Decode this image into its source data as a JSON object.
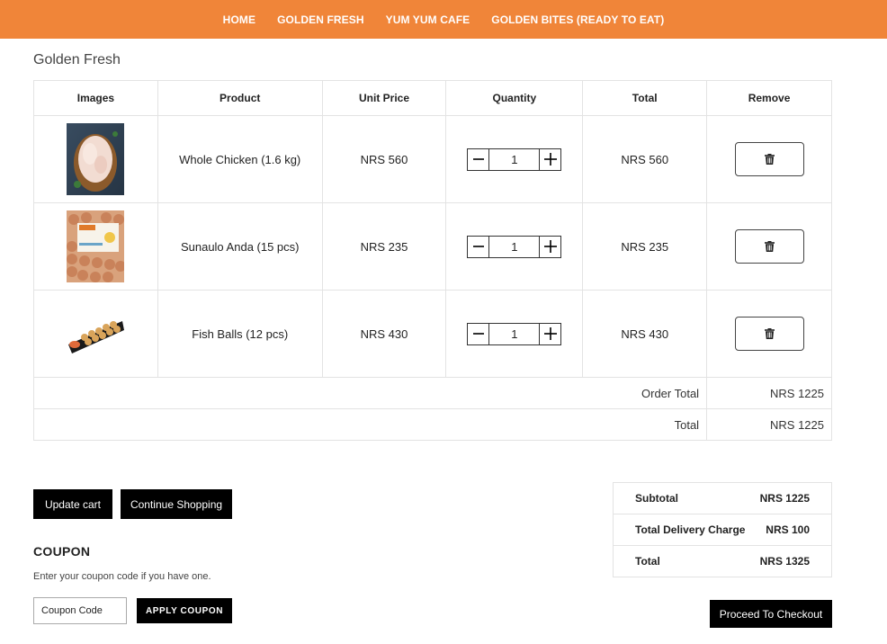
{
  "nav": {
    "items": [
      "HOME",
      "GOLDEN FRESH",
      "YUM YUM CAFE",
      "GOLDEN BITES (READY TO EAT)"
    ],
    "bg_color": "#f08539"
  },
  "page_title": "Golden Fresh",
  "cart": {
    "headers": [
      "Images",
      "Product",
      "Unit Price",
      "Quantity",
      "Total",
      "Remove"
    ],
    "rows": [
      {
        "image": "whole-chicken-photo",
        "product": "Whole Chicken (1.6 kg)",
        "unit_price": "NRS 560",
        "quantity": "1",
        "total": "NRS 560"
      },
      {
        "image": "egg-tray-photo",
        "product": "Sunaulo Anda (15 pcs)",
        "unit_price": "NRS 235",
        "quantity": "1",
        "total": "NRS 235"
      },
      {
        "image": "fish-balls-photo",
        "product": "Fish Balls (12 pcs)",
        "unit_price": "NRS 430",
        "quantity": "1",
        "total": "NRS 430"
      }
    ],
    "order_total_label": "Order Total",
    "order_total_value": "NRS 1225",
    "total_label": "Total",
    "total_value": "NRS 1225"
  },
  "actions": {
    "update_cart": "Update cart",
    "continue_shopping": "Continue Shopping"
  },
  "coupon": {
    "heading": "COUPON",
    "description": "Enter your coupon code if you have one.",
    "placeholder": "Coupon Code",
    "apply_label": "APPLY COUPON"
  },
  "totals": {
    "subtotal_label": "Subtotal",
    "subtotal_value": "NRS 1225",
    "delivery_label": "Total Delivery Charge",
    "delivery_value": "NRS 100",
    "total_label": "Total",
    "total_value": "NRS 1325"
  },
  "checkout_label": "Proceed To Checkout",
  "icons": {
    "minus": "minus-icon",
    "plus": "plus-icon",
    "remove": "trash-icon"
  }
}
